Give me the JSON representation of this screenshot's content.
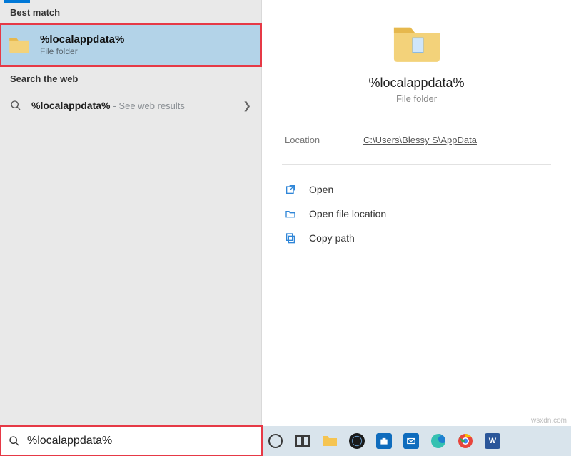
{
  "left": {
    "best_match_heading": "Best match",
    "best_match": {
      "title": "%localappdata%",
      "subtitle": "File folder"
    },
    "web_heading": "Search the web",
    "web_title": "%localappdata%",
    "web_suffix": " - See web results"
  },
  "right": {
    "title": "%localappdata%",
    "subtitle": "File folder",
    "location_label": "Location",
    "location_value": "C:\\Users\\Blessy S\\AppData",
    "actions": {
      "open": "Open",
      "open_loc": "Open file location",
      "copy_path": "Copy path"
    }
  },
  "taskbar": {
    "search_value": "%localappdata%"
  },
  "watermark": "wsxdn.com"
}
